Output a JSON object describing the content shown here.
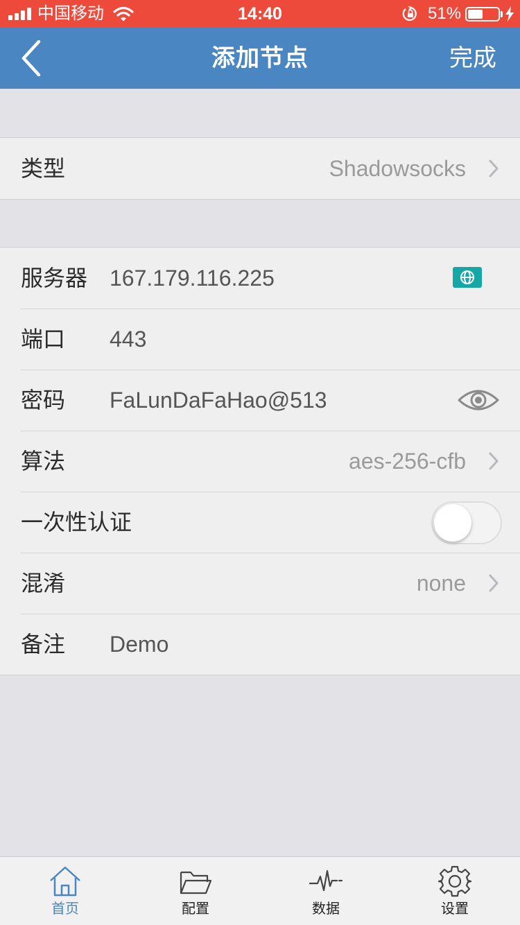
{
  "status_bar": {
    "carrier": "中国移动",
    "time": "14:40",
    "battery_percent": "51%",
    "battery_level": 0.51,
    "icons": [
      "signal-icon",
      "wifi-icon",
      "orientation-lock-icon",
      "battery-icon",
      "charging-bolt-icon"
    ]
  },
  "nav": {
    "back_icon": "chevron-left-icon",
    "title": "添加节点",
    "done_label": "完成"
  },
  "type_row": {
    "label": "类型",
    "value": "Shadowsocks"
  },
  "fields": {
    "server": {
      "label": "服务器",
      "value": "167.179.116.225",
      "icon": "globe-icon"
    },
    "port": {
      "label": "端口",
      "value": "443"
    },
    "password": {
      "label": "密码",
      "value": "FaLunDaFaHao@513",
      "icon": "eye-icon"
    },
    "algorithm": {
      "label": "算法",
      "value": "aes-256-cfb"
    },
    "ota": {
      "label": "一次性认证",
      "enabled": false
    },
    "obfs": {
      "label": "混淆",
      "value": "none"
    },
    "remark": {
      "label": "备注",
      "value": "Demo"
    }
  },
  "tab_bar": {
    "active": 0,
    "active_color": "#4a86c1",
    "tabs": [
      {
        "label": "首页",
        "icon": "home-icon"
      },
      {
        "label": "配置",
        "icon": "folder-icon"
      },
      {
        "label": "数据",
        "icon": "pulse-icon"
      },
      {
        "label": "设置",
        "icon": "gear-icon"
      }
    ]
  },
  "colors": {
    "status_bar": "#ee4a3c",
    "nav_bar": "#4a86c1",
    "background": "#e2e2e7",
    "cell_background": "#efefef",
    "globe_button": "#14a7a5"
  }
}
